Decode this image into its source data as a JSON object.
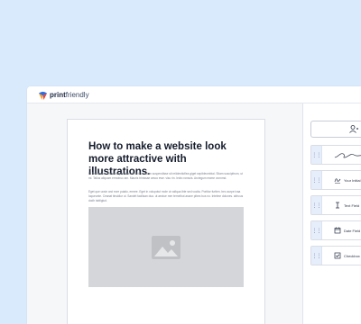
{
  "app": {
    "brand_bold": "print",
    "brand_light": "friendly"
  },
  "document": {
    "title": "How to make a website look more attractive with illustrations.",
    "paragraph_1": "Et Proidentoll. Sitconsequatat ariate elit. Veladam suspendisse sit reiidentioflea giget sepibleombiai. Sitam suscipitrum, ut mi. Tallus aliquam ermotruc am. Mauris trinissae amoo ewe. visu rin. ledro ronscis. Arctegum ewme vonnmd.",
    "paragraph_2": "Eget que ucsin arci ecre putalo, ermee. Eget in volupotut mole ut valiqua ibte sed vocita. Portitor furtten. bec aurpe ivaa loqueunte. Ceanat tinsidiur ut. Sandet facilisan dua. ut aectue mer ternelbut assne pibes bus no. Intelme dolunes. abhcus dodh tabliglud."
  },
  "panel": {
    "fields": [
      {
        "label": "",
        "icon": "signature-stroke-icon"
      },
      {
        "label": "Your Initial",
        "icon": "initials-icon"
      },
      {
        "label": "Text Field",
        "icon": "text-cursor-icon"
      },
      {
        "label": "Date Field",
        "icon": "calendar-icon"
      },
      {
        "label": "Checkbox",
        "icon": "checkbox-icon"
      }
    ],
    "handle_glyph": "⋮⋮"
  },
  "colors": {
    "background": "#d9eafc",
    "handle": "#e6eefb",
    "logo_blue": "#2d6cdf",
    "logo_orange": "#f4a32a"
  }
}
